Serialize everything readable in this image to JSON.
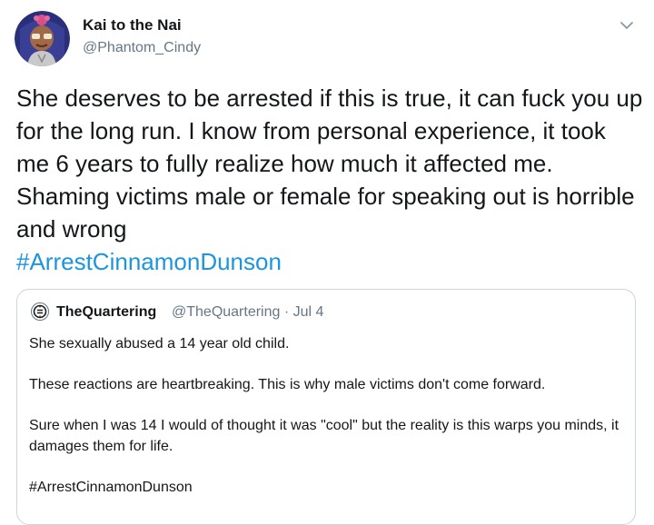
{
  "author": {
    "display_name": "Kai to the Nai",
    "handle": "@Phantom_Cindy"
  },
  "tweet": {
    "text": "She deserves to be arrested if this is true, it can fuck you up for the long run. I know from personal experience, it took me 6 years to fully realize how much it affected me. Shaming victims male or female for speaking out is horrible and wrong",
    "hashtag": "#ArrestCinnamonDunson"
  },
  "quoted_tweet": {
    "display_name": "TheQuartering",
    "handle": "@TheQuartering",
    "separator": "·",
    "date": "Jul 4",
    "paragraphs": [
      "She sexually abused a 14 year old child.",
      "These reactions are heartbreaking. This is why male victims don't come forward.",
      "Sure when I was 14 I would of thought it was \"cool\" but the reality is this warps you minds, it damages them for life.",
      "#ArrestCinnamonDunson"
    ]
  },
  "colors": {
    "link": "#1b95e0",
    "secondary_text": "#657786",
    "border": "#ccd6dd"
  },
  "icons": {
    "menu": "chevron-down-icon"
  }
}
